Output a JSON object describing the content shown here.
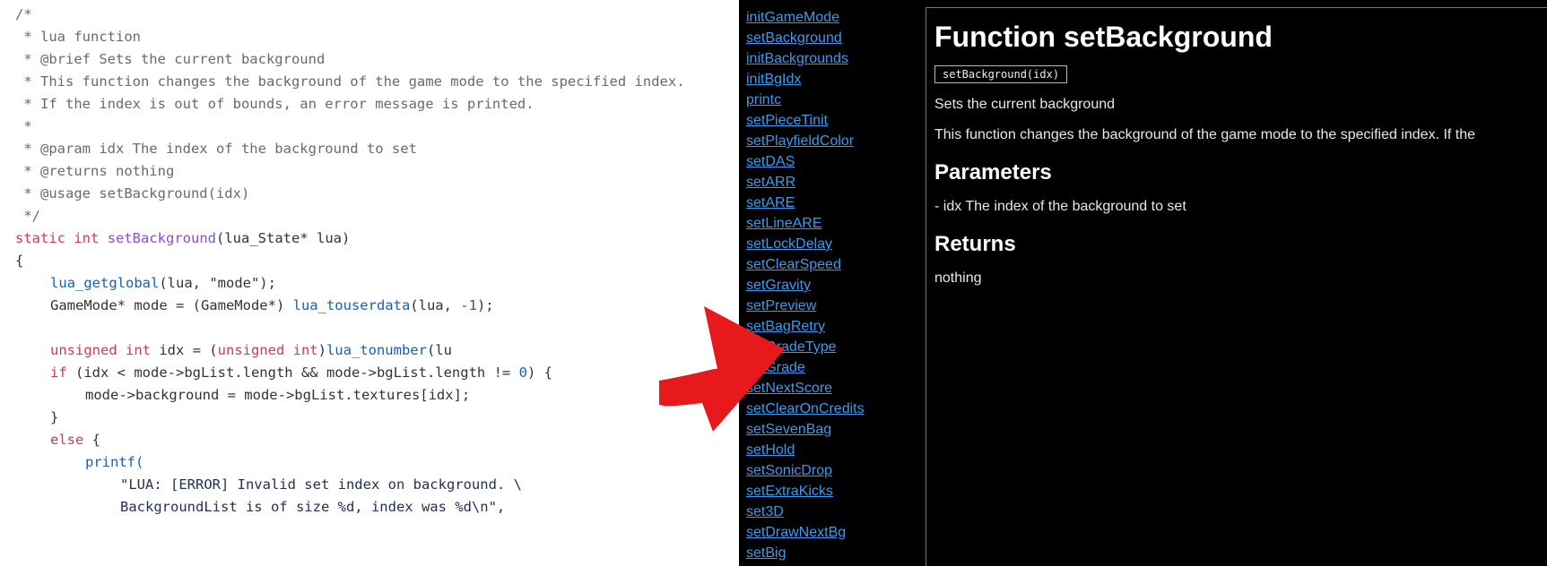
{
  "code": {
    "comment_open": "/*",
    "comment_lines": [
      " * lua function",
      " * @brief Sets the current background",
      " * This function changes the background of the game mode to the specified index.",
      " * If the index is out of bounds, an error message is printed.",
      " *",
      " * @param idx The index of the background to set",
      " * @returns nothing",
      " * @usage setBackground(idx)"
    ],
    "comment_close": " */",
    "sig_static": "static",
    "sig_int": "int",
    "sig_name": "setBackground",
    "sig_params": "(lua_State* lua)",
    "brace_open": "{",
    "l_getglobal_fn": "lua_getglobal",
    "l_getglobal_args": "(lua, \"mode\");",
    "l_mode_decl": "GameMode* mode = (GameMode*) ",
    "l_mode_fn": "lua_touserdata",
    "l_mode_args_a": "(lua, ",
    "l_mode_num": "-1",
    "l_mode_args_b": ");",
    "l_idx_kw1": "unsigned int",
    "l_idx_mid": " idx = (",
    "l_idx_kw2": "unsigned int",
    "l_idx_cast_end": ")",
    "l_idx_fn": "lua_tonumber",
    "l_idx_args": "(lu",
    "l_if_kw": "if",
    "l_if_cond": " (idx < mode->bgList.length && mode->bgList.length != ",
    "l_if_num": "0",
    "l_if_end": ") {",
    "l_assign": "mode->background = mode->bgList.textures[idx];",
    "l_close_brace": "}",
    "l_else_kw": "else",
    "l_else_brace": " {",
    "l_printf": "printf(",
    "l_str1": "\"LUA: [ERROR] Invalid set index on background. \\",
    "l_str2": "BackgroundList is of size %d, index was %d\\n\","
  },
  "nav": {
    "items": [
      "initGameMode",
      "setBackground",
      "initBackgrounds",
      "initBgIdx",
      "printc",
      "setPieceTinit",
      "setPlayfieldColor",
      "setDAS",
      "setARR",
      "setARE",
      "setLineARE",
      "setLockDelay",
      "setClearSpeed",
      "setGravity",
      "setPreview",
      "setBagRetry",
      "setGradeType",
      "setGrade",
      "setNextScore",
      "setClearOnCredits",
      "setSevenBag",
      "setHold",
      "setSonicDrop",
      "setExtraKicks",
      "set3D",
      "setDrawNextBg",
      "setBig"
    ]
  },
  "doc": {
    "title": "Function setBackground",
    "signature": "setBackground(idx)",
    "brief": "Sets the current background",
    "description": "This function changes the background of the game mode to the specified index. If the",
    "params_heading": "Parameters",
    "param_line": "- idx The index of the background to set",
    "returns_heading": "Returns",
    "returns_text": "nothing"
  },
  "colors": {
    "arrow": "#e8191d",
    "link": "#3a9aee",
    "keyword": "#d73a49",
    "function_name": "#8a4fc9"
  }
}
